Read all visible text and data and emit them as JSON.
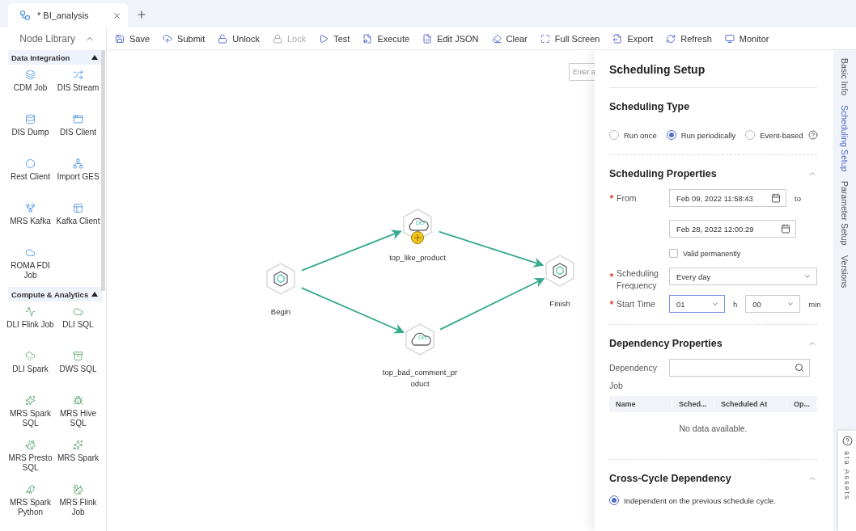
{
  "tabs": [
    {
      "title": "* BI_analysis",
      "selected": true
    }
  ],
  "node_library": {
    "title": "Node Library",
    "sections": [
      {
        "title": "Data Integration",
        "expanded": true,
        "items": [
          "CDM Job",
          "DIS Stream",
          "DIS Dump",
          "DIS Client",
          "Rest Client",
          "Import GES",
          "MRS Kafka",
          "Kafka Client",
          "ROMA FDI Job"
        ]
      },
      {
        "title": "Compute & Analytics",
        "expanded": true,
        "items": [
          "DLI Flink Job",
          "DLI SQL",
          "DLI Spark",
          "DWS SQL",
          "MRS Spark SQL",
          "MRS Hive SQL",
          "MRS Presto SQL",
          "MRS Spark",
          "MRS Spark Python",
          "MRS Flink Job"
        ]
      }
    ]
  },
  "toolbar": [
    {
      "label": "Save",
      "disabled": false
    },
    {
      "label": "Submit",
      "disabled": false
    },
    {
      "label": "Unlock",
      "disabled": false
    },
    {
      "label": "Lock",
      "disabled": true
    },
    {
      "label": "Test",
      "disabled": false
    },
    {
      "label": "Execute",
      "disabled": false
    },
    {
      "label": "Edit JSON",
      "disabled": false
    },
    {
      "label": "Clear",
      "disabled": false
    },
    {
      "label": "Full Screen",
      "disabled": false
    },
    {
      "label": "Export",
      "disabled": false
    },
    {
      "label": "Refresh",
      "disabled": false
    },
    {
      "label": "Monitor",
      "disabled": false
    }
  ],
  "canvas": {
    "search": {
      "placeholder": "Enter a"
    },
    "nodes": [
      {
        "label": "Begin",
        "kind": "start",
        "hovered": false
      },
      {
        "label": "top_like_product",
        "kind": "dli",
        "type_label": "DLI",
        "hovered": true
      },
      {
        "label": "top_bad_comment_product",
        "kind": "dli",
        "type_label": "DLI",
        "hovered": false
      },
      {
        "label": "Finish",
        "kind": "end",
        "hovered": false
      }
    ]
  },
  "panel": {
    "title": "Scheduling Setup",
    "scheduling_type": {
      "title": "Scheduling Type",
      "options": [
        {
          "label": "Run once",
          "selected": false,
          "help": false
        },
        {
          "label": "Run periodically",
          "selected": true,
          "help": false
        },
        {
          "label": "Event-based",
          "selected": false,
          "help": true
        }
      ]
    },
    "properties": {
      "title": "Scheduling Properties",
      "expanded": true,
      "from": {
        "label": "From",
        "required": true,
        "start": "Feb 09, 2022 11:58:43",
        "to_label": "to",
        "end": "Feb 28, 2022 12:00:29"
      },
      "valid_permanently": {
        "label": "Valid permanently",
        "checked": false
      },
      "frequency": {
        "label": "Scheduling Frequency",
        "required": true,
        "value": "Every day"
      },
      "start_time": {
        "label": "Start Time",
        "required": true,
        "hour": "01",
        "hour_unit": "h",
        "minute": "00",
        "minute_unit": "min"
      }
    },
    "dependency": {
      "title": "Dependency Properties",
      "expanded": true,
      "field": {
        "label": "Dependency Job"
      },
      "table": {
        "columns": [
          "Name",
          "Sched...",
          "Scheduled At",
          "Op..."
        ],
        "empty_text": "No data available."
      }
    },
    "cross_cycle": {
      "title": "Cross-Cycle Dependency",
      "expanded": true,
      "options": [
        {
          "label": "Independent on the previous schedule cycle.",
          "selected": true
        }
      ]
    }
  },
  "side_tabs": [
    {
      "label": "Basic Info",
      "selected": false
    },
    {
      "label": "Scheduling Setup",
      "selected": true
    },
    {
      "label": "Parameter Setup",
      "selected": false
    },
    {
      "label": "Versions",
      "selected": false
    }
  ],
  "assets_tab": {
    "label": "ata Assets"
  }
}
